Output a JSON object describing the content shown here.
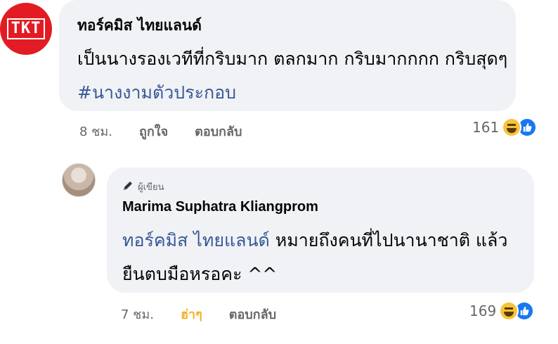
{
  "comment1": {
    "author": "ทอร์คมิส ไทยแลนด์",
    "avatar_text": "TKT",
    "text": "เป็นนางรองเวทีที่กริบมาก ตลกมาก กริบมากกกก กริบสุดๆ",
    "hashtag": "#นางงามตัวประกอบ",
    "time": "8 ชม.",
    "like_label": "ถูกใจ",
    "reply_label": "ตอบกลับ",
    "reaction_count": "161",
    "reactions": [
      "haha-icon",
      "like-icon"
    ]
  },
  "comment2": {
    "badge": "ผู้เขียน",
    "author": "Marima Suphatra Kliangprom",
    "mention": "ทอร์คมิส ไทยแลนด์",
    "text": " หมายถึงคนที่ไปนานาชาติ แล้วยืนตบมือหรอคะ ^^",
    "time": "7 ชม.",
    "like_label": "ฮ่าๆ",
    "reply_label": "ตอบกลับ",
    "reaction_count": "169",
    "reactions": [
      "haha-icon",
      "like-icon"
    ]
  },
  "colors": {
    "bubble": "#f0f2f5",
    "link": "#385898",
    "meta": "#65676b",
    "haha_active": "#f7b125",
    "like_blue": "#1877f2",
    "brand_red": "#e31b23"
  }
}
